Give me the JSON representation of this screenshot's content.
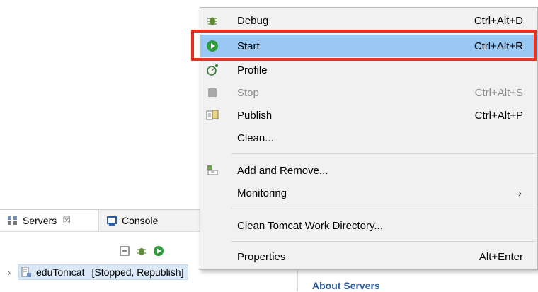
{
  "menu": {
    "items": [
      {
        "label": "Debug",
        "shortcut": "Ctrl+Alt+D",
        "icon": "debug-bug-icon"
      },
      {
        "label": "Start",
        "shortcut": "Ctrl+Alt+R",
        "icon": "start-run-icon",
        "selected": true
      },
      {
        "label": "Profile",
        "shortcut": "",
        "icon": "profile-icon"
      },
      {
        "label": "Stop",
        "shortcut": "Ctrl+Alt+S",
        "icon": "stop-icon",
        "disabled": true
      },
      {
        "label": "Publish",
        "shortcut": "Ctrl+Alt+P",
        "icon": "publish-icon"
      },
      {
        "label": "Clean...",
        "shortcut": ""
      },
      {
        "label": "Add and Remove...",
        "shortcut": "",
        "icon": "add-remove-icon"
      },
      {
        "label": "Monitoring",
        "shortcut": "",
        "submenu": true
      },
      {
        "label": "Clean Tomcat Work Directory...",
        "shortcut": ""
      },
      {
        "label": "Properties",
        "shortcut": "Alt+Enter"
      }
    ],
    "submenu_arrow": "›"
  },
  "views": {
    "servers_tab": "Servers",
    "servers_tab_close": "☒",
    "console_tab": "Console"
  },
  "server": {
    "name": "eduTomcat",
    "status": "[Stopped, Republish]"
  },
  "info_panel": {
    "heading": "About Servers"
  },
  "colors": {
    "highlight_border": "#e8321f",
    "selected_item": "#99c8f5",
    "menu_bg": "#f1f1f1",
    "run_green": "#2e9c3a"
  }
}
